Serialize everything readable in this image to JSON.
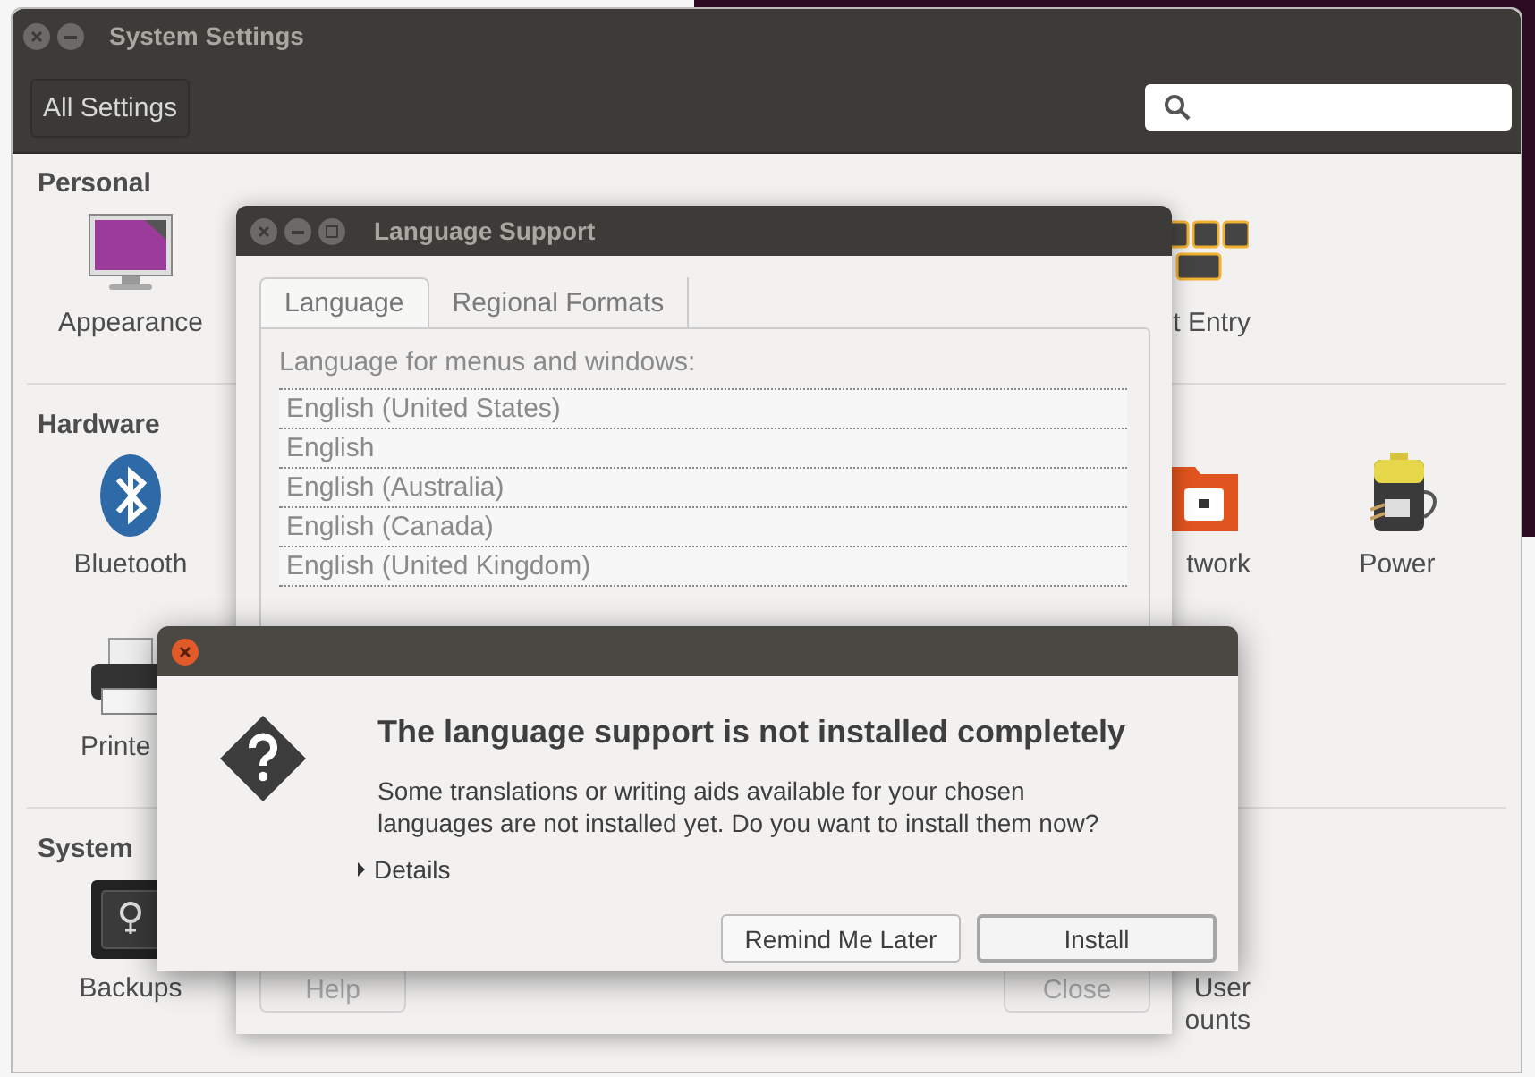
{
  "main_window": {
    "title": "System Settings",
    "all_settings_button": "All Settings"
  },
  "sections": [
    {
      "title": "Personal",
      "rows": [
        [
          {
            "lines": [
              "Appearance"
            ]
          },
          {
            "lines": [
              "t Entry"
            ]
          }
        ]
      ]
    },
    {
      "title": "Hardware",
      "rows": [
        [
          {
            "lines": [
              "Bluetooth"
            ]
          },
          {
            "lines": [
              "twork"
            ]
          },
          {
            "lines": [
              "Power"
            ]
          }
        ],
        [
          {
            "lines": [
              "Printe"
            ]
          }
        ]
      ]
    },
    {
      "title": "System",
      "rows": [
        [
          {
            "lines": [
              "Backups"
            ]
          },
          {
            "lines": [
              "User",
              "ounts"
            ]
          }
        ]
      ]
    }
  ],
  "language_window": {
    "title": "Language Support",
    "tabs": [
      {
        "label": "Language",
        "selected": true
      },
      {
        "label": "Regional Formats",
        "selected": false
      }
    ],
    "list_label": "Language for menus and windows:",
    "languages": [
      "English (United States)",
      "English",
      "English (Australia)",
      "English (Canada)",
      "English (United Kingdom)"
    ],
    "buttons": [
      "Help",
      "Close"
    ]
  },
  "dialog": {
    "title": "The language support is not installed completely",
    "message": "Some translations or writing aids available for your chosen languages are not installed yet. Do you want to install them now?",
    "details": {
      "label": "Details",
      "expanded": false
    },
    "buttons": [
      {
        "label": "Remind Me Later",
        "default": false
      },
      {
        "label": "Install",
        "default": true
      }
    ]
  }
}
